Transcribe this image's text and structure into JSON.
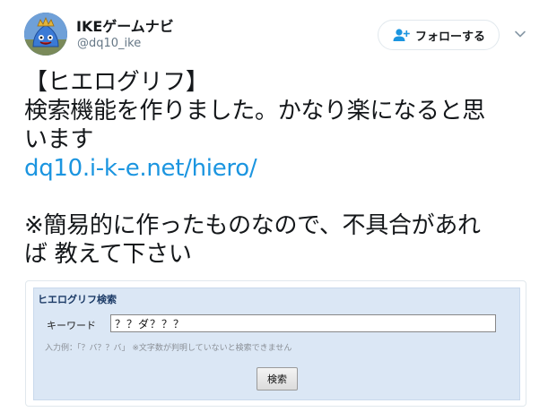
{
  "author": {
    "display_name": "IKEゲームナビ",
    "handle": "@dq10_ike",
    "avatar_icon": "slime-avatar-icon"
  },
  "follow_button": {
    "label": "フォローする",
    "icon": "follow-user-icon"
  },
  "menu_icon": "chevron-down-icon",
  "tweet": {
    "lines": [
      "【ヒエログリフ】",
      "検索機能を作りました。かなり楽になると思",
      "います"
    ],
    "link": "dq10.i-k-e.net/hiero/",
    "lines2": [
      "※簡易的に作ったものなので、不具合があれ",
      "ば 教えて下さい"
    ]
  },
  "card": {
    "title": "ヒエログリフ検索",
    "input_label": "キーワード",
    "input_value": "？？ダ？？？",
    "hint": "入力例：「？バ？？バ」 ※文字数が判明していないと検索できません",
    "search_button": "検索"
  },
  "colors": {
    "link": "#1b95e0",
    "card_background": "#dbe7f5",
    "secondary_text": "#657786"
  }
}
